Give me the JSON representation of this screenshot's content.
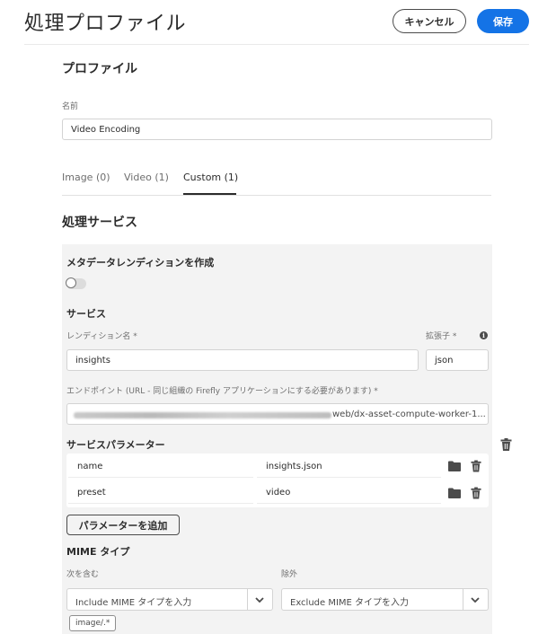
{
  "header": {
    "title": "処理プロファイル",
    "cancel_label": "キャンセル",
    "save_label": "保存",
    "save_color": "#1473e6"
  },
  "profile": {
    "heading": "プロファイル",
    "name_label": "名前",
    "name_value": "Video Encoding"
  },
  "tabs": [
    {
      "label": "Image (0)",
      "active": false
    },
    {
      "label": "Video (1)",
      "active": false
    },
    {
      "label": "Custom (1)",
      "active": true
    }
  ],
  "processing": {
    "heading": "処理サービス",
    "metadata_rendition_label": "メタデータレンディションを作成",
    "metadata_rendition_on": false,
    "service_heading": "サービス",
    "rendition_name_label": "レンディション名 *",
    "rendition_name_value": "insights",
    "extension_label": "拡張子 *",
    "extension_value": "json",
    "endpoint_label": "エンドポイント (URL - 同じ組織の Firefly アプリケーションにする必要があります) *",
    "endpoint_visible_text": "web/dx-asset-compute-worker-1...",
    "params_heading": "サービスパラメーター",
    "params": [
      {
        "key": "name",
        "value": "insights.json"
      },
      {
        "key": "preset",
        "value": "video"
      }
    ],
    "add_param_label": "パラメーターを追加",
    "mime_heading": "MIME タイプ",
    "include_label": "次を含む",
    "exclude_label": "除外",
    "include_placeholder": "Include MIME タイプを入力",
    "exclude_placeholder": "Exclude MIME タイプを入力",
    "include_tags": [
      "image/.*"
    ]
  },
  "icons": {
    "delete": "trash-icon",
    "browse": "folder-icon",
    "info": "info-icon",
    "dropdown": "chevron-down-icon"
  }
}
